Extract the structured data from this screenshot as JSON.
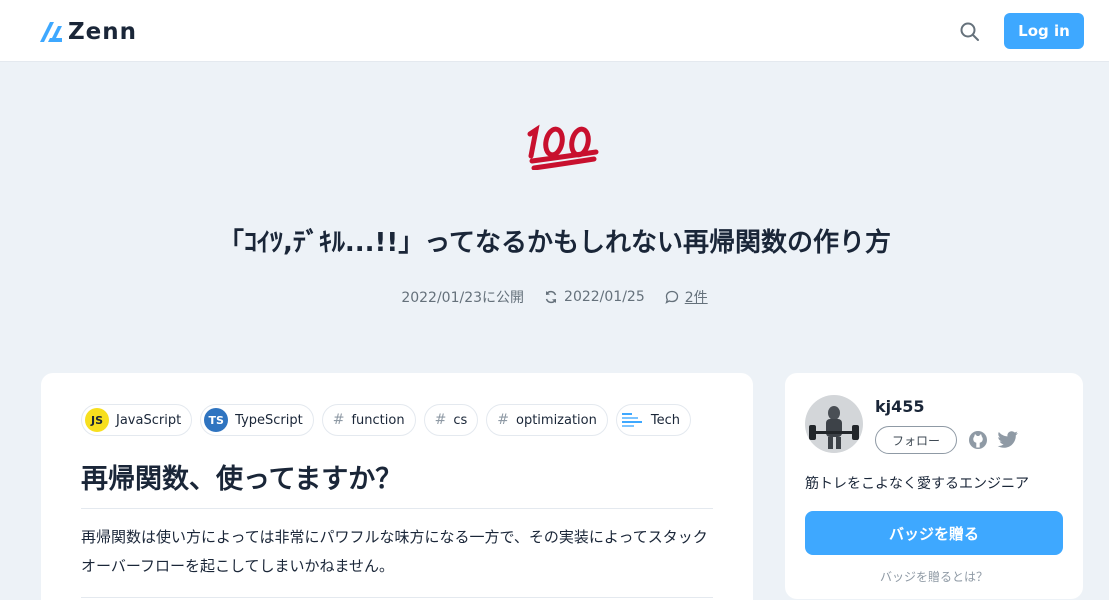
{
  "header": {
    "logo_text": "Zenn",
    "login_label": "Log in",
    "brand_color": "#3ea8ff"
  },
  "hero": {
    "emoji": "100-emoji",
    "title": "「ｺｲﾂ,ﾃﾞｷﾙ...!!」ってなるかもしれない再帰関数の作り方",
    "published": "2022/01/23に公開",
    "updated": "2022/01/25",
    "comments": "2件"
  },
  "topics": [
    {
      "label": "JavaScript",
      "icon": "JS"
    },
    {
      "label": "TypeScript",
      "icon": "TS"
    },
    {
      "label": "function",
      "icon": "#"
    },
    {
      "label": "cs",
      "icon": "#"
    },
    {
      "label": "optimization",
      "icon": "#"
    },
    {
      "label": "Tech",
      "icon": "tech-icon"
    }
  ],
  "article": {
    "heading": "再帰関数、使ってますか？",
    "paragraph": "再帰関数は使い方によっては非常にパワフルな味方になる一方で、その実装によってスタックオーバーフローを起こしてしまいかねません。"
  },
  "author": {
    "name": "kj455",
    "follow_label": "フォロー",
    "bio": "筋トレをこよなく愛するエンジニア",
    "badge_label": "バッジを贈る",
    "badge_help": "バッジを贈るとは？"
  }
}
